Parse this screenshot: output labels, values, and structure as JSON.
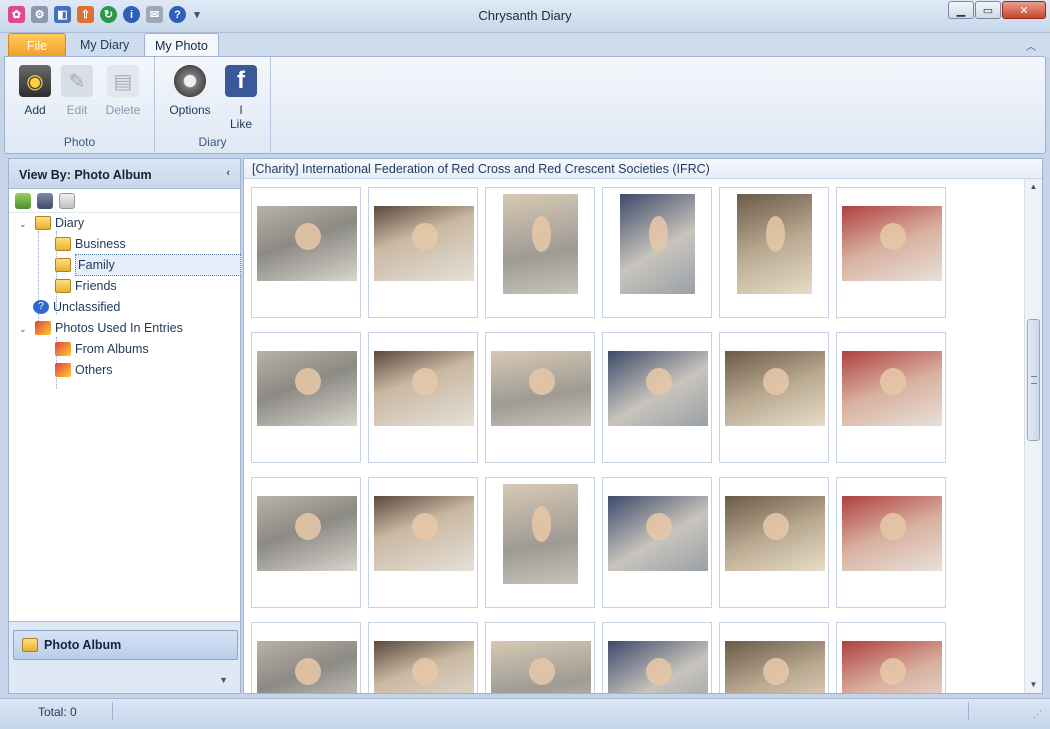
{
  "window": {
    "title": "Chrysanth Diary"
  },
  "qat": [
    "butterfly-icon",
    "gear-icon",
    "import-icon",
    "export-icon",
    "sync-icon",
    "info-icon",
    "mail-icon",
    "help-icon"
  ],
  "tabs": {
    "file": "File",
    "my_diary": "My Diary",
    "my_photo": "My Photo"
  },
  "ribbon": {
    "photo_group": {
      "label": "Photo",
      "add": "Add",
      "edit": "Edit",
      "delete": "Delete"
    },
    "diary_group": {
      "label": "Diary",
      "options": "Options",
      "like": "I Like"
    }
  },
  "left_panel": {
    "header": "View By: Photo Album",
    "tree": {
      "diary": "Diary",
      "business": "Business",
      "family": "Family",
      "friends": "Friends",
      "unclassified": "Unclassified",
      "photos_used": "Photos Used In Entries",
      "from_albums": "From Albums",
      "others": "Others"
    },
    "footer_button": "Photo Album"
  },
  "main": {
    "album_title": "[Charity] International Federation of Red Cross and Red Crescent Societies (IFRC)"
  },
  "status": {
    "total": "Total: 0"
  },
  "colors": {
    "file_tab": "#f0a028",
    "accent": "#1e395b",
    "close": "#c8462c"
  }
}
